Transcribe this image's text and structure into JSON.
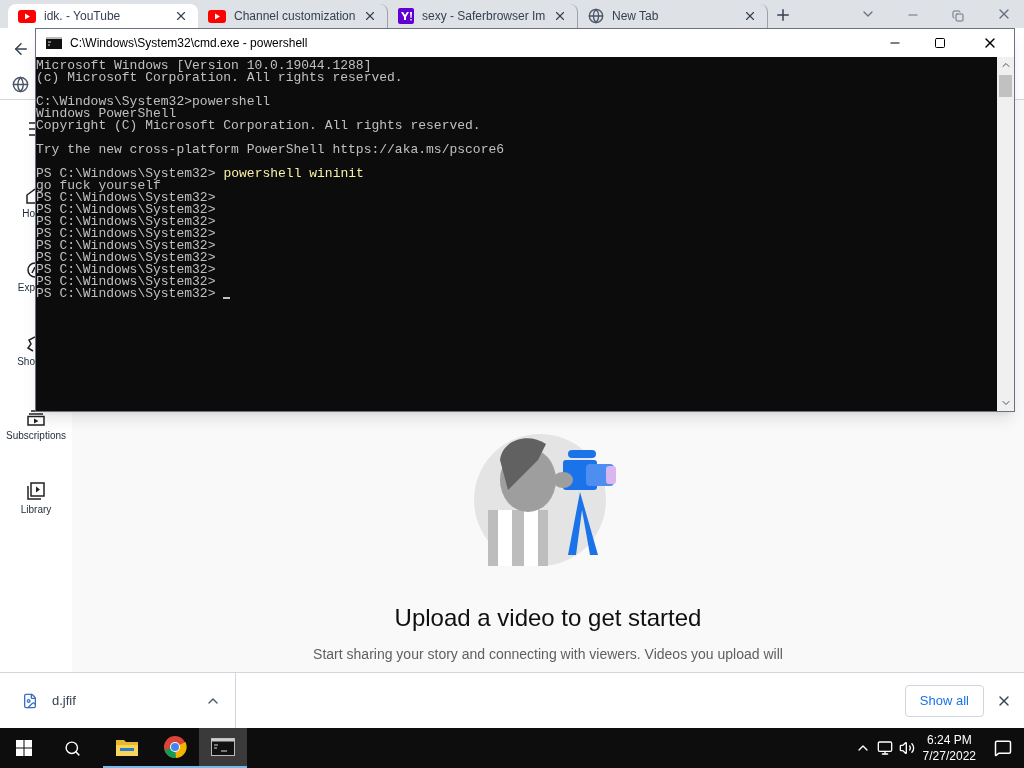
{
  "browser": {
    "tabs": [
      {
        "title": "idk. - YouTube",
        "selected": true
      },
      {
        "title": "Channel customization",
        "selected": false
      },
      {
        "title": "sexy - Saferbrowser Im",
        "selected": false
      },
      {
        "title": "New Tab",
        "selected": false
      }
    ]
  },
  "sidebar": {
    "items": [
      {
        "label": "Ho"
      },
      {
        "label": "Exp"
      },
      {
        "label": "Sho"
      },
      {
        "label": "Subscriptions"
      },
      {
        "label": "Library"
      }
    ]
  },
  "empty_state": {
    "title": "Upload a video to get started",
    "text": "Start sharing your story and connecting with viewers. Videos you upload will"
  },
  "terminal": {
    "title": "C:\\Windows\\System32\\cmd.exe - powershell",
    "cursor_visible": true,
    "lines": [
      {
        "kind": "output",
        "text": "Microsoft Windows [Version 10.0.19044.1288]"
      },
      {
        "kind": "output",
        "text": "(c) Microsoft Corporation. All rights reserved."
      },
      {
        "kind": "blank"
      },
      {
        "kind": "output",
        "text": "C:\\Windows\\System32>powershell"
      },
      {
        "kind": "output",
        "text": "Windows PowerShell"
      },
      {
        "kind": "output",
        "text": "Copyright (C) Microsoft Corporation. All rights reserved."
      },
      {
        "kind": "blank"
      },
      {
        "kind": "output",
        "text": "Try the new cross-platform PowerShell https://aka.ms/pscore6"
      },
      {
        "kind": "blank"
      },
      {
        "kind": "input",
        "prompt": "PS C:\\Windows\\System32>",
        "command": "powershell wininit"
      },
      {
        "kind": "output",
        "text": "go fuck yourself"
      },
      {
        "kind": "output",
        "text": "PS C:\\Windows\\System32>"
      },
      {
        "kind": "output",
        "text": "PS C:\\Windows\\System32>"
      },
      {
        "kind": "output",
        "text": "PS C:\\Windows\\System32>"
      },
      {
        "kind": "output",
        "text": "PS C:\\Windows\\System32>"
      },
      {
        "kind": "output",
        "text": "PS C:\\Windows\\System32>"
      },
      {
        "kind": "output",
        "text": "PS C:\\Windows\\System32>"
      },
      {
        "kind": "output",
        "text": "PS C:\\Windows\\System32>"
      },
      {
        "kind": "output",
        "text": "PS C:\\Windows\\System32>"
      },
      {
        "kind": "output",
        "text": "PS C:\\Windows\\System32>"
      }
    ]
  },
  "download_bar": {
    "file": "d.jfif",
    "show_all": "Show all"
  },
  "taskbar": {
    "apps": [
      {
        "active": false
      },
      {
        "active": false
      },
      {
        "active": true
      }
    ],
    "time": "6:24 PM",
    "date": "7/27/2022"
  }
}
